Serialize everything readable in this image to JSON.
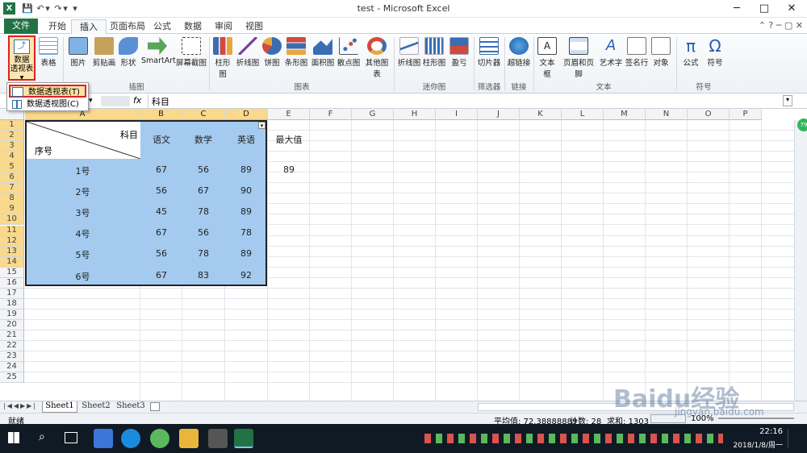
{
  "window": {
    "title": "test - Microsoft Excel",
    "controls": [
      "─",
      "□",
      "✕"
    ]
  },
  "quick_access": [
    "💾",
    "↶",
    "▾",
    "↷",
    "▾",
    "▾"
  ],
  "tabs": [
    "文件",
    "开始",
    "插入",
    "页面布局",
    "公式",
    "数据",
    "审阅",
    "视图"
  ],
  "ribbon": {
    "pivot_label": "数据\n透视表 ▾",
    "table": "表格",
    "picture": "图片",
    "clipart": "剪贴画",
    "shapes": "形状",
    "smartart": "SmartArt",
    "screenshot": "屏幕截图",
    "bar": "柱形图",
    "line": "折线图",
    "pie": "饼图",
    "hbar": "条形图",
    "area": "面积图",
    "scatter": "散点图",
    "other": "其他图表",
    "sp_line": "折线图",
    "sp_bar": "柱形图",
    "sp_wl": "盈亏",
    "slicer": "切片器",
    "hyperlink": "超链接",
    "textbox": "文本框",
    "header": "页眉和页脚",
    "wordart": "艺术字",
    "signature": "签名行",
    "object": "对象",
    "formula": "公式",
    "symbol": "符号",
    "groups": {
      "illus": "插图",
      "charts": "图表",
      "spark": "迷你图",
      "filter": "筛选器",
      "link": "链接",
      "text": "文本",
      "sym": "符号"
    }
  },
  "dropdown": {
    "item1": "数据透视表(T)",
    "item2": "数据透视图(C)"
  },
  "formula_bar": {
    "fx": "fx",
    "content": "科目"
  },
  "grid": {
    "columns": [
      "A",
      "B",
      "C",
      "D",
      "E",
      "F",
      "G",
      "H",
      "I",
      "J",
      "K",
      "L",
      "M",
      "N",
      "O",
      "P"
    ],
    "rows": [
      "1",
      "2",
      "3",
      "4",
      "5",
      "6",
      "7",
      "8",
      "9",
      "10",
      "11",
      "12",
      "13",
      "14",
      "15",
      "16",
      "17",
      "18",
      "19",
      "20",
      "21",
      "22",
      "23",
      "24",
      "25"
    ],
    "header_subject": "科目",
    "header_id": "序号",
    "headers": [
      "语文",
      "数学",
      "英语"
    ],
    "max_label": "最大值",
    "max_value": "89",
    "data": [
      {
        "id": "1号",
        "v": [
          "67",
          "56",
          "89"
        ]
      },
      {
        "id": "2号",
        "v": [
          "56",
          "67",
          "90"
        ]
      },
      {
        "id": "3号",
        "v": [
          "45",
          "78",
          "89"
        ]
      },
      {
        "id": "4号",
        "v": [
          "67",
          "56",
          "78"
        ]
      },
      {
        "id": "5号",
        "v": [
          "56",
          "78",
          "89"
        ]
      },
      {
        "id": "6号",
        "v": [
          "67",
          "83",
          "92"
        ]
      }
    ]
  },
  "sheets": [
    "Sheet1",
    "Sheet2",
    "Sheet3"
  ],
  "status": {
    "ready": "就绪",
    "avg": "平均值: 72.38888889",
    "count": "计数: 28",
    "sum": "求和: 1303",
    "zoom": "100%"
  },
  "taskbar": {
    "time": "22:16",
    "date": "2018/1/8/周一"
  },
  "watermark": "Baidu经验",
  "watermark_sub": "jingyan.baidu.com",
  "colors": {
    "excel_green": "#217346",
    "selection": "#a4cbef",
    "highlight": "#e02020"
  }
}
